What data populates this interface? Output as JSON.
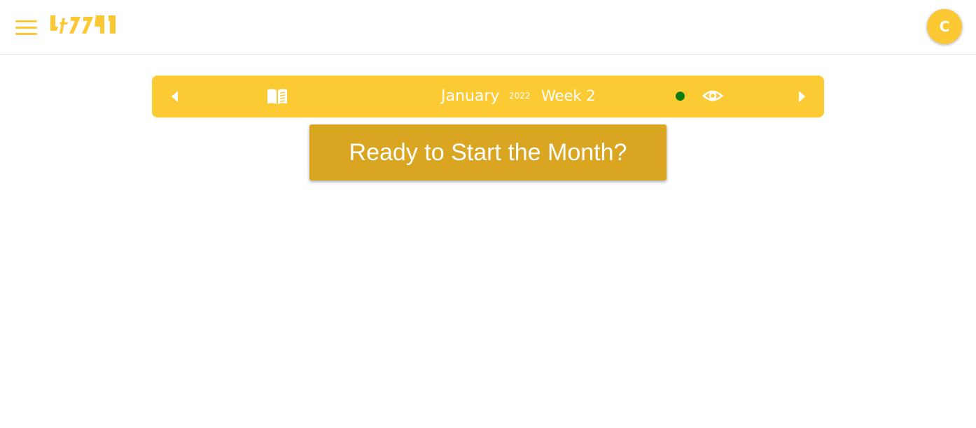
{
  "header": {
    "menu_icon": "hamburger-menu-icon",
    "logo_icon": "app-logo",
    "avatar_initial": "C"
  },
  "week_nav": {
    "prev_icon": "chevron-left-icon",
    "book_icon": "book-icon",
    "month": "January",
    "year": "2022",
    "week": "Week 2",
    "status_color": "#0d7a0d",
    "view_icon": "eye-icon",
    "next_icon": "chevron-right-icon"
  },
  "main": {
    "start_button_label": "Ready to Start the Month?"
  },
  "colors": {
    "accent": "#fcca33",
    "button": "#daa621",
    "text_on_accent": "#ffffff"
  }
}
